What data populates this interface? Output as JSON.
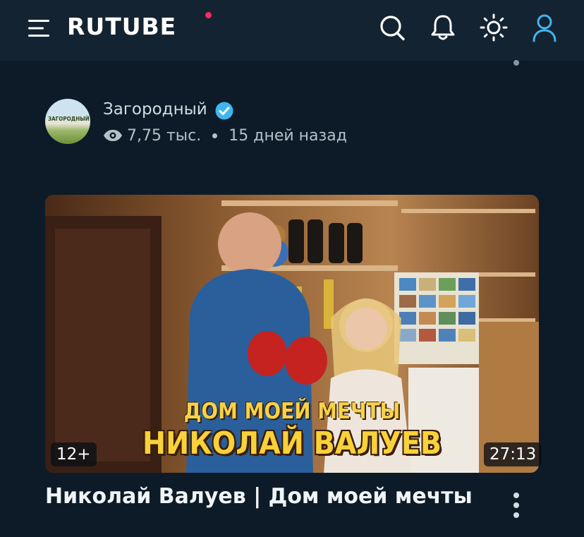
{
  "header": {
    "logo_text": "RUTUBE",
    "logo_dot_color": "#ff2a5b",
    "icons": [
      "menu-icon",
      "search-icon",
      "bell-icon",
      "sun-icon",
      "user-icon"
    ],
    "user_icon_color": "#3fb6f0"
  },
  "channel": {
    "name": "Загородный",
    "avatar_text": "ЗАГОРОДНЫЙ",
    "verified": true,
    "views": "7,75 тыс.",
    "published": "15 дней назад"
  },
  "video": {
    "thumbnail_subtitle": "ДОМ МОЕЙ МЕЧТЫ",
    "thumbnail_title": "НИКОЛАЙ ВАЛУЕВ",
    "age_rating": "12+",
    "duration": "27:13",
    "title": "Николай Валуев | Дом моей мечты"
  }
}
